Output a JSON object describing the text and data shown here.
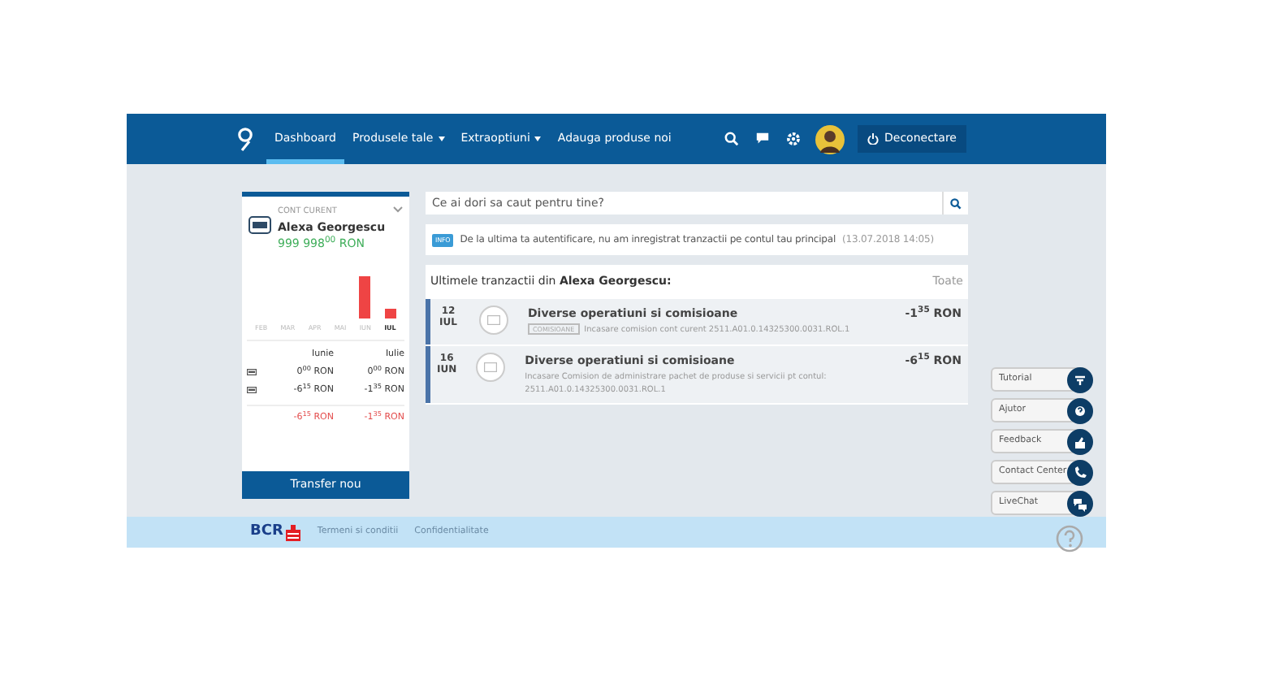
{
  "nav": {
    "items": [
      {
        "label": "Dashboard",
        "selected": true,
        "dropdown": false
      },
      {
        "label": "Produsele tale",
        "selected": false,
        "dropdown": true
      },
      {
        "label": "Extraoptiuni",
        "selected": false,
        "dropdown": true
      },
      {
        "label": "Adauga produse noi",
        "selected": false,
        "dropdown": false
      }
    ],
    "logout": "Deconectare"
  },
  "account": {
    "type": "CONT CURENT",
    "owner": "Alexa Georgescu",
    "balance": "999 998$^{00}$ RON",
    "months": [
      {
        "label": "FEB",
        "selected": false
      },
      {
        "label": "MAR",
        "selected": false
      },
      {
        "label": "APR",
        "selected": false
      },
      {
        "label": "MAI",
        "selected": false
      },
      {
        "label": "IUN",
        "selected": false
      },
      {
        "label": "IUL",
        "selected": true
      }
    ],
    "columns": [
      "Iunie",
      "Iulie"
    ],
    "rows": [
      {
        "cells": [
          "0$^{00}$ RON",
          "0$^{00}$ RON"
        ]
      },
      {
        "cells": [
          "-6$^{15}$ RON",
          "-1$^{35}$ RON"
        ]
      }
    ],
    "total": [
      "-6$^{15}$ RON",
      "-1$^{35}$ RON"
    ],
    "button": "Transfer nou"
  },
  "search": {
    "placeholder": "Ce ai dori sa caut pentru tine?"
  },
  "info": {
    "badge": "INFO",
    "text": "De la ultima ta autentificare, nu am inregistrat tranzactii pe contul tau principal",
    "time": "(13.07.2018 14:05)"
  },
  "transactions": {
    "title": "Ultimele tranzactii din **Alexa Georgescu:**",
    "all": "Toate",
    "items": [
      {
        "day": "12",
        "month": "IUL",
        "title": "Diverse operatiuni si comisioane",
        "tag": "COMISIOANE",
        "description": "Incasare comision cont curent 2511.A01.0.14325300.0031.ROL.1",
        "amount": "-1$^{35}$ RON"
      },
      {
        "day": "16",
        "month": "IUN",
        "title": "Diverse operatiuni si comisioane",
        "description": "Incasare Comision de administrare pachet de produse si servicii pt contul: 2511.A01.0.14325300.0031.ROL.1",
        "amount": "-6$^{15}$ RON"
      }
    ]
  },
  "help": [
    {
      "label": "Tutorial",
      "kind": "tutorial"
    },
    {
      "label": "Ajutor",
      "kind": "help"
    },
    {
      "label": "Feedback",
      "kind": "feedback"
    },
    {
      "label": "Contact Center",
      "kind": "phone"
    },
    {
      "label": "LiveChat",
      "kind": "chat"
    }
  ],
  "footer": {
    "brand": "BCR",
    "links": [
      "Termeni si conditii",
      "Confidentialitate"
    ]
  }
}
